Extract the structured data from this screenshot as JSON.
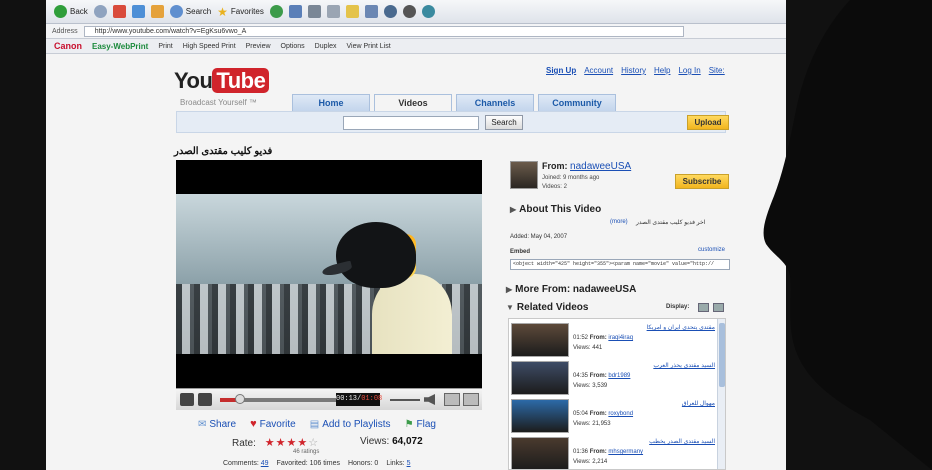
{
  "browser": {
    "toolbar": {
      "back_label": "Back",
      "search_label": "Search",
      "favorites_label": "Favorites"
    },
    "address": {
      "label": "Address",
      "url": "http://www.youtube.com/watch?v=EgKsu6vwo_A"
    },
    "canon_bar": {
      "brand": "Canon",
      "product": "Easy-WebPrint",
      "print": "Print",
      "high_speed": "High Speed Print",
      "preview": "Preview",
      "options": "Options",
      "duplex": "Duplex",
      "view_list": "View Print List"
    }
  },
  "youtube": {
    "logo_you": "You",
    "logo_tube": "Tube",
    "slogan": "Broadcast Yourself ™",
    "top_links": [
      "Sign Up",
      "Account",
      "History",
      "Help",
      "Log In",
      "Site:"
    ],
    "tabs": [
      "Home",
      "Videos",
      "Channels",
      "Community"
    ],
    "search_button": "Search",
    "upload_button": "Upload",
    "video_title": "فديو كليب مقتدى الصدر",
    "player": {
      "time_current": "00:13",
      "time_total": "01:08",
      "progress": 0.17
    },
    "actions": {
      "share": "Share",
      "favorite": "Favorite",
      "add_to_playlists": "Add to Playlists",
      "flag": "Flag"
    },
    "rating": {
      "label": "Rate:",
      "stars": 4,
      "max": 5,
      "count_text": "46 ratings"
    },
    "views": {
      "label": "Views:",
      "value": "64,072"
    },
    "stats": {
      "comments_label": "Comments:",
      "comments": "49",
      "favorited": "Favorited: 106 times",
      "honors": "Honors: 0",
      "links_label": "Links:",
      "links": "5"
    },
    "channel": {
      "from_label": "From:",
      "name": "nadaweeUSA",
      "joined": "Joined: 9 months ago",
      "videos": "Videos: 2",
      "subscribe": "Subscribe"
    },
    "about": {
      "heading": "About This Video",
      "description": "اخر فديو كليب مقتدى الصدر",
      "more": "(more)",
      "added": "Added: May 04, 2007",
      "embed_label": "Embed",
      "customize": "customize",
      "embed_code": "<object width=\"425\" height=\"355\"><param name=\"movie\" value=\"http://"
    },
    "more_from": "More From: nadaweeUSA",
    "related": {
      "heading": "Related Videos",
      "display_label": "Display:",
      "items": [
        {
          "title": "مقتدى يتحدى ايران و امريكا",
          "duration": "01:52",
          "from_label": "From:",
          "user": "iraqi4iraq",
          "views": "Views: 441",
          "thumb": "#5d4a3a"
        },
        {
          "title": "السيد مقتدى يحذر العرب",
          "duration": "04:35",
          "from_label": "From:",
          "user": "bdr1989",
          "views": "Views: 3,539",
          "thumb": "#3e4c66"
        },
        {
          "title": "مهوال للعراق",
          "duration": "05:04",
          "from_label": "From:",
          "user": "roxybond",
          "views": "Views: 21,953",
          "thumb": "#2c6aa8"
        },
        {
          "title": "السيد مقتدى الصدر يخطب",
          "duration": "01:36",
          "from_label": "From:",
          "user": "mhsgermany",
          "views": "Views: 2,214",
          "thumb": "#4a3a2e"
        }
      ]
    }
  },
  "colors": {
    "brand_red": "#d0242b",
    "link_blue": "#1a4fb5",
    "button_yellow": "#f2b51e"
  }
}
